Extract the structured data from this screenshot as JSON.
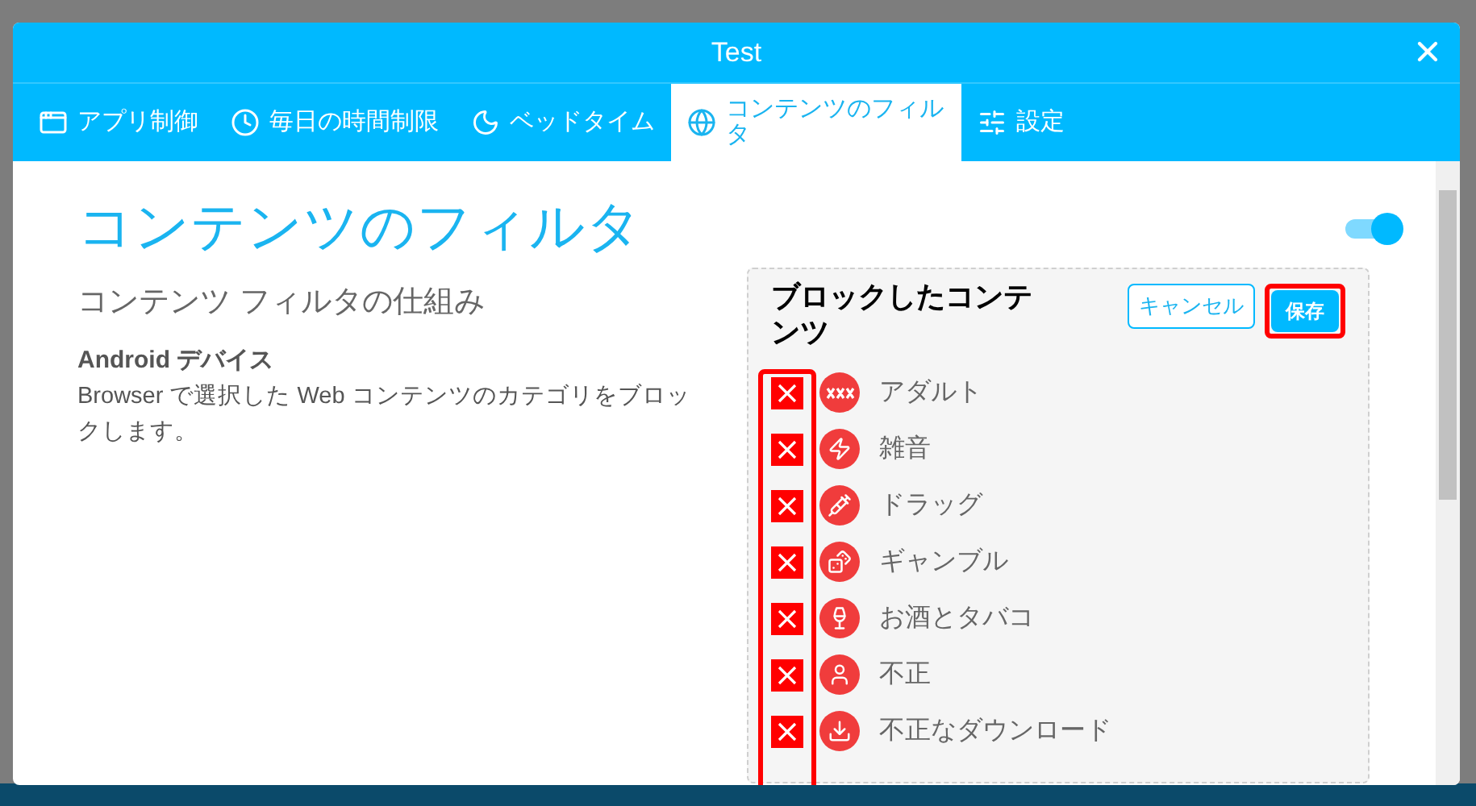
{
  "window": {
    "title": "Test"
  },
  "tabs": [
    {
      "label": "アプリ制御",
      "selected": false
    },
    {
      "label": "毎日の時間制限",
      "selected": false
    },
    {
      "label": "ベッドタイム",
      "selected": false
    },
    {
      "label": "コンテンツのフィルタ",
      "selected": true
    },
    {
      "label": "設定",
      "selected": false
    }
  ],
  "page": {
    "title": "コンテンツのフィルタ",
    "enabled": true,
    "subtitle": "コンテンツ フィルタの仕組み",
    "device": "Android デバイス",
    "description": "Browser で選択した Web コンテンツのカテゴリをブロックします。"
  },
  "panel": {
    "title": "ブロックしたコンテンツ",
    "buttons": [
      "キャンセル",
      "保存"
    ],
    "categories": [
      {
        "label": "アダルト",
        "checked": true
      },
      {
        "label": "雑音",
        "checked": true
      },
      {
        "label": "ドラッグ",
        "checked": true
      },
      {
        "label": "ギャンブル",
        "checked": true
      },
      {
        "label": "お酒とタバコ",
        "checked": true
      },
      {
        "label": "不正",
        "checked": true
      },
      {
        "label": "不正なダウンロード",
        "checked": true
      }
    ]
  }
}
